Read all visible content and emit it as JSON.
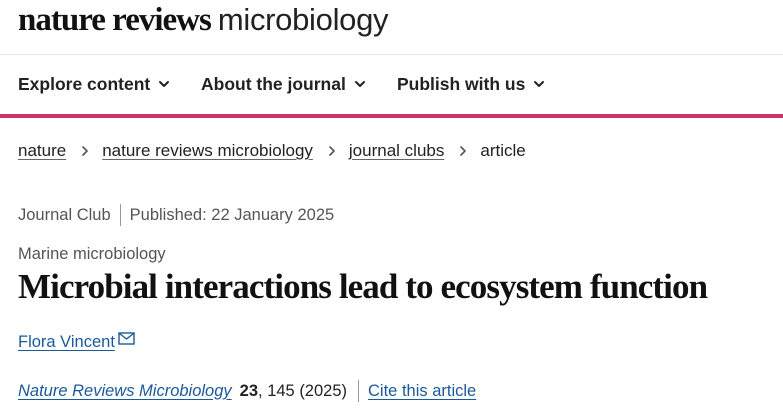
{
  "header": {
    "logo_bold": "nature reviews",
    "logo_light": "microbiology"
  },
  "nav": {
    "items": [
      {
        "label": "Explore content",
        "icon": "chevron-down-icon"
      },
      {
        "label": "About the journal",
        "icon": "chevron-down-icon"
      },
      {
        "label": "Publish with us",
        "icon": "chevron-down-icon"
      }
    ],
    "accent_color": "#cc3366"
  },
  "breadcrumb": {
    "items": [
      "nature",
      "nature reviews microbiology",
      "journal clubs"
    ],
    "current": "article",
    "separator_icon": "chevron-right-icon"
  },
  "article": {
    "type": "Journal Club",
    "published": "Published: 22 January 2025",
    "subject": "Marine microbiology",
    "title": "Microbial interactions lead to ecosystem function",
    "author": "Flora Vincent",
    "author_icon": "mail-icon",
    "journal": "Nature Reviews Microbiology",
    "volume": "23",
    "pages_year": ", 145 (2025)",
    "cite_label": "Cite this article",
    "link_color": "#1a5a9c"
  }
}
